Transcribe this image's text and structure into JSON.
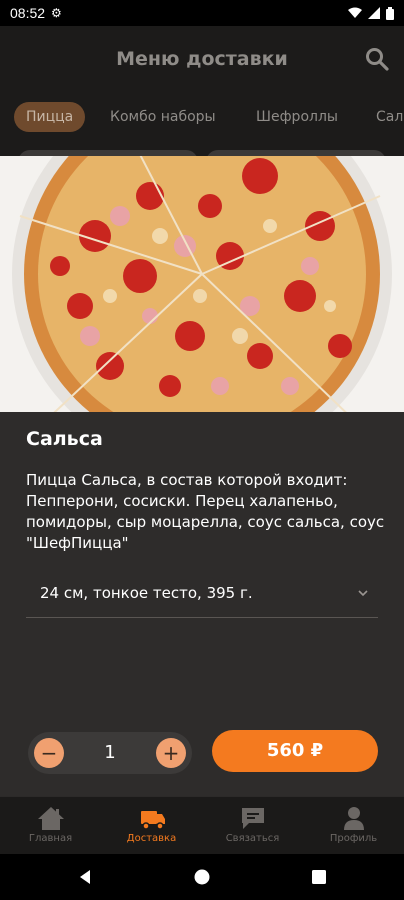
{
  "status_bar": {
    "time": "08:52"
  },
  "header": {
    "title": "Меню доставки"
  },
  "tabs": [
    {
      "label": "Пицца",
      "active": true
    },
    {
      "label": "Комбо наборы",
      "active": false
    },
    {
      "label": "Шефроллы",
      "active": false
    },
    {
      "label": "Сал",
      "active": false
    }
  ],
  "product": {
    "name": "Сальса",
    "description": "Пицца Сальса, в состав которой входит: Пепперони, сосиски. Перец халапеньо, помидоры, сыр моцарелла, соус сальса, соус \"ШефПицца\"",
    "variant": "24 см, тонкое тесто, 395 г.",
    "quantity": "1",
    "price": "560 ₽",
    "minus": "−",
    "plus": "+"
  },
  "bottom_nav": [
    {
      "label": "Главная",
      "icon": "home-icon",
      "active": false
    },
    {
      "label": "Доставка",
      "icon": "delivery-truck-icon",
      "active": true
    },
    {
      "label": "Связаться",
      "icon": "chat-icon",
      "active": false
    },
    {
      "label": "Профиль",
      "icon": "profile-icon",
      "active": false
    }
  ],
  "colors": {
    "accent": "#f47a1f",
    "sheet": "#2e2c2b",
    "background": "#1c1b1a"
  }
}
